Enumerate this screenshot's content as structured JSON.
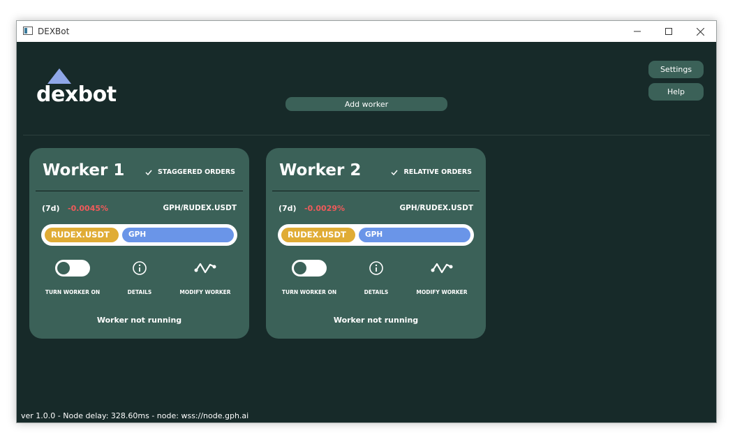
{
  "window": {
    "title": "DEXBot",
    "controls": {
      "minimize_icon": "minimize-icon",
      "maximize_icon": "maximize-icon",
      "close_icon": "close-icon"
    }
  },
  "header": {
    "logo_text": "dexbot",
    "settings_label": "Settings",
    "help_label": "Help",
    "add_worker_label": "Add worker"
  },
  "colors": {
    "background": "#172a29",
    "card": "#3b6158",
    "logo_triangle": "#8fa7e8",
    "negative_change": "#f05a5a",
    "base_asset": "#e0ac35",
    "quote_asset": "#6a95e8"
  },
  "workers": [
    {
      "name": "Worker 1",
      "strategy": "STAGGERED ORDERS",
      "period": "(7d)",
      "change": "-0.0045%",
      "pair": "GPH/RUDEX.USDT",
      "base_asset": "RUDEX.USDT",
      "quote_asset": "GPH",
      "toggle_label": "TURN WORKER ON",
      "toggle_on": false,
      "details_label": "DETAILS",
      "modify_label": "MODIFY WORKER",
      "status": "Worker not running"
    },
    {
      "name": "Worker 2",
      "strategy": "RELATIVE ORDERS",
      "period": "(7d)",
      "change": "-0.0029%",
      "pair": "GPH/RUDEX.USDT",
      "base_asset": "RUDEX.USDT",
      "quote_asset": "GPH",
      "toggle_label": "TURN WORKER ON",
      "toggle_on": false,
      "details_label": "DETAILS",
      "modify_label": "MODIFY WORKER",
      "status": "Worker not running"
    }
  ],
  "footer": {
    "status_text": "ver 1.0.0 - Node delay: 328.60ms - node: wss://node.gph.ai"
  }
}
